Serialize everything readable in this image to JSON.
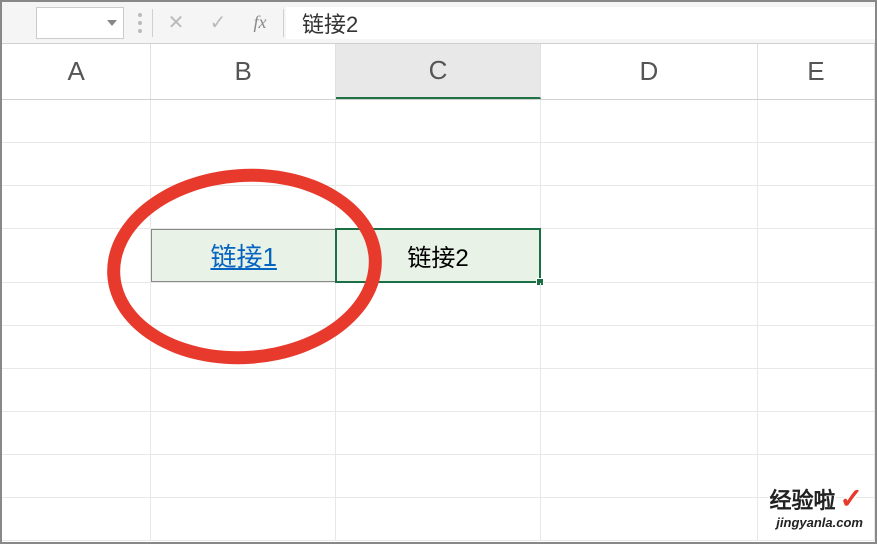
{
  "formula_bar": {
    "cancel_icon": "✕",
    "confirm_icon": "✓",
    "fx_label": "fx",
    "value": "链接2"
  },
  "columns": {
    "A": "A",
    "B": "B",
    "C": "C",
    "D": "D",
    "E": "E"
  },
  "cells": {
    "b4_link": "链接1",
    "c4_text": "链接2"
  },
  "watermark": {
    "main": "经验啦",
    "check": "✓",
    "sub": "jingyanla.com"
  }
}
